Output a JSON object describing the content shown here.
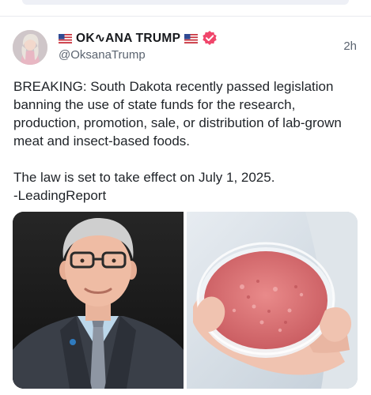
{
  "post": {
    "author": {
      "display_name": "OK∿ANA TRUMP",
      "handle": "@OksanaTrump",
      "verified": true,
      "flag_icon": "us-flag-icon",
      "avatar_icon": "avatar"
    },
    "time_ago": "2h",
    "text": "BREAKING: South Dakota recently passed legislation banning the use of state funds for the research, production, promotion, sale, or distribution of lab-grown meat and insect-based foods.\n\nThe law is set to take effect on July 1, 2025.\n-LeadingReport",
    "media": [
      {
        "icon": "portrait-photo"
      },
      {
        "icon": "lab-meat-petri-dish-photo"
      }
    ]
  },
  "colors": {
    "verified_badge": "#f0466b",
    "text_primary": "#1f2328",
    "text_secondary": "#5b6470"
  }
}
